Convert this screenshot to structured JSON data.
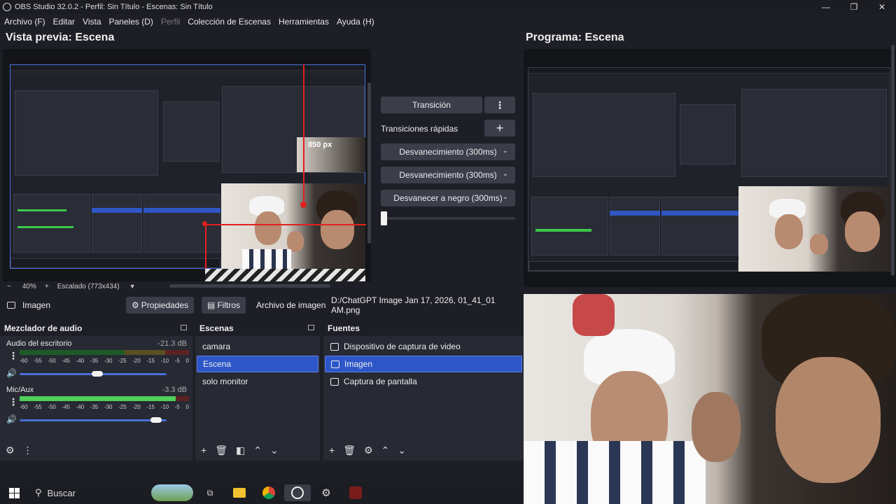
{
  "window": {
    "title": "OBS Studio 32.0.2 - Perfil: Sin Título - Escenas: Sin Título"
  },
  "window_controls": {
    "minimize": "—",
    "maximize": "❐",
    "close": "✕"
  },
  "menu": [
    {
      "label": "Archivo (F)",
      "disabled": false
    },
    {
      "label": "Editar",
      "disabled": false
    },
    {
      "label": "Vista",
      "disabled": false
    },
    {
      "label": "Paneles (D)",
      "disabled": false
    },
    {
      "label": "Perfil",
      "disabled": true
    },
    {
      "label": "Colección de Escenas",
      "disabled": false
    },
    {
      "label": "Herramientas",
      "disabled": false
    },
    {
      "label": "Ayuda (H)",
      "disabled": false
    }
  ],
  "preview": {
    "title": "Vista previa: Escena",
    "size_label": "850 px",
    "zoom": "40%",
    "zoom_minus": "−",
    "zoom_plus": "+",
    "scale_mode": "Escalado (773x434)"
  },
  "program": {
    "title": "Programa: Escena"
  },
  "transitions": {
    "transition_button": "Transición",
    "quick_label": "Transiciones rápidas",
    "items": [
      "Desvanecimiento (300ms)",
      "Desvanecimiento (300ms)",
      "Desvanecer a negro (300ms)"
    ]
  },
  "source_toolbar": {
    "source_name": "Imagen",
    "properties": "Propiedades",
    "filters": "Filtros",
    "image_file_label": "Archivo de imagen",
    "image_path": "D:/ChatGPT Image Jan 17, 2026, 01_41_01 AM.png"
  },
  "mixer": {
    "title": "Mezclador de audio",
    "ticks": [
      "-60",
      "-55",
      "-50",
      "-45",
      "-40",
      "-35",
      "-30",
      "-25",
      "-20",
      "-15",
      "-10",
      "-5",
      "0"
    ],
    "channels": [
      {
        "name": "Audio del escritorio",
        "db": "-21.3 dB",
        "level": 0.0,
        "volume": 0.53
      },
      {
        "name": "Mic/Aux",
        "db": "-3.3 dB",
        "level": 0.92,
        "volume": 0.93
      }
    ]
  },
  "scenes": {
    "title": "Escenas",
    "items": [
      {
        "label": "camara",
        "selected": false
      },
      {
        "label": "Escena",
        "selected": true
      },
      {
        "label": "solo monitor",
        "selected": false
      }
    ]
  },
  "sources": {
    "title": "Fuentes",
    "items": [
      {
        "label": "Dispositivo de captura de video",
        "icon": "camera-icon",
        "selected": false
      },
      {
        "label": "Imagen",
        "icon": "image-icon",
        "selected": true
      },
      {
        "label": "Captura de pantalla",
        "icon": "monitor-icon",
        "selected": false
      }
    ]
  },
  "taskbar": {
    "search_placeholder": "Buscar"
  },
  "colors": {
    "accent": "#2d57c8",
    "background": "#1e1f26",
    "dock": "#272933",
    "red_guide": "#e02020"
  }
}
